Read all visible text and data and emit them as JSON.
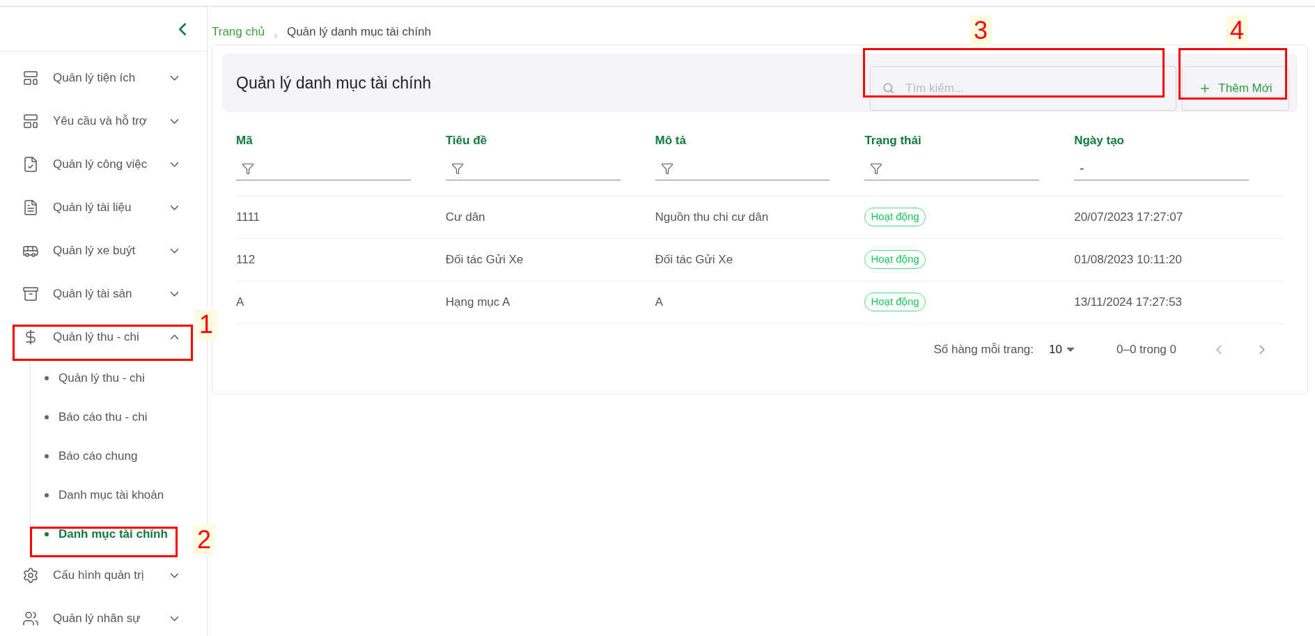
{
  "sidebar": {
    "items": [
      {
        "label": "Quản lý tiện ích",
        "expanded": false
      },
      {
        "label": "Yêu cầu và hỗ trợ",
        "expanded": false
      },
      {
        "label": "Quản lý công việc",
        "expanded": false
      },
      {
        "label": "Quản lý tài liệu",
        "expanded": false
      },
      {
        "label": "Quản lý xe buýt",
        "expanded": false
      },
      {
        "label": "Quản lý tài sản",
        "expanded": false
      },
      {
        "label": "Quản lý thu - chi",
        "expanded": true,
        "children": [
          {
            "label": "Quản lý thu - chi",
            "selected": false
          },
          {
            "label": "Báo cáo thu - chi",
            "selected": false
          },
          {
            "label": "Báo cáo chung",
            "selected": false
          },
          {
            "label": "Danh mục tài khoản",
            "selected": false
          },
          {
            "label": "Danh mục tài chính",
            "selected": true
          }
        ]
      },
      {
        "label": "Cấu hình quản trị",
        "expanded": false
      },
      {
        "label": "Quản lý nhân sự",
        "expanded": false
      }
    ]
  },
  "breadcrumb": [
    "Trang chủ",
    "Quản lý danh mục tài chính"
  ],
  "page_title": "Quản lý danh mục tài chính",
  "search": {
    "placeholder": "Tìm kiếm..."
  },
  "add_button": "Thêm Mới",
  "table": {
    "columns": [
      {
        "label": "Mã",
        "kind": "filter"
      },
      {
        "label": "Tiêu đề",
        "kind": "filter"
      },
      {
        "label": "Mô tả",
        "kind": "filter"
      },
      {
        "label": "Trạng thái",
        "kind": "filter"
      },
      {
        "label": "Ngày tạo",
        "kind": "date",
        "value": "-"
      }
    ],
    "rows": [
      [
        "1111",
        "Cư dân",
        "Nguồn thu chi cư dân",
        "Hoạt động",
        "20/07/2023 17:27:07"
      ],
      [
        "112",
        "Đối tác Gửi Xe",
        "Đối tác Gửi Xe",
        "Hoạt động",
        "01/08/2023 10:11:20"
      ],
      [
        "A",
        "Hạng mục A",
        "A",
        "Hoạt động",
        "13/11/2024 17:27:53"
      ]
    ]
  },
  "pagination": {
    "rows_label": "Số hàng mỗi trang:",
    "rows_value": "10",
    "range": "0–0 trong 0"
  },
  "annotations": [
    {
      "label": "1"
    },
    {
      "label": "2"
    },
    {
      "label": "3"
    },
    {
      "label": "4"
    }
  ]
}
